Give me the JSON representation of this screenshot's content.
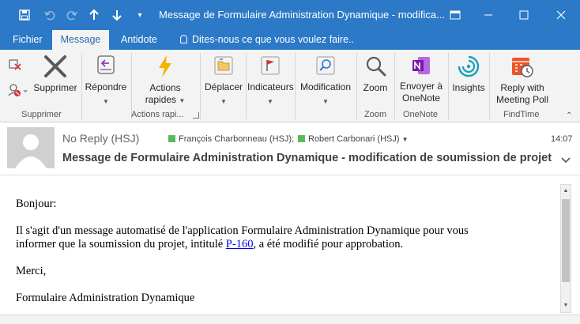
{
  "window": {
    "title": "Message de Formulaire Administration Dynamique - modifica...",
    "accent": "#2b79c7"
  },
  "quick_access": {
    "save_icon": "save-icon",
    "undo_icon": "undo-icon",
    "redo_icon": "redo-icon",
    "up_icon": "up-arrow-icon",
    "down_icon": "down-arrow-icon",
    "customize_icon": "customize-icon"
  },
  "tabs": [
    {
      "label": "Fichier"
    },
    {
      "label": "Message"
    },
    {
      "label": "Antidote"
    }
  ],
  "tell_me": "Dites-nous ce que vous voulez faire..",
  "ribbon": {
    "delete_label": "Supprimer",
    "reply_label": "Répondre",
    "quick_actions_l1": "Actions",
    "quick_actions_l2": "rapides",
    "move_label": "Déplacer",
    "tags_label": "Indicateurs",
    "edit_label": "Modification",
    "zoom_label": "Zoom",
    "onenote_l1": "Envoyer à",
    "onenote_l2": "OneNote",
    "insights_label": "Insights",
    "meeting_l1": "Reply with",
    "meeting_l2": "Meeting Poll",
    "groups": {
      "delete": "Supprimer",
      "quick_actions": "Actions rapi...",
      "zoom": "Zoom",
      "onenote": "OneNote",
      "findtime": "FindTime"
    }
  },
  "message": {
    "sender": "No Reply (HSJ)",
    "recipient1": "François Charbonneau (HSJ);",
    "recipient2": "Robert Carbonari (HSJ)",
    "time": "14:07",
    "subject": "Message de Formulaire Administration Dynamique - modification de soumission de projet"
  },
  "body": {
    "greeting": "Bonjour:",
    "line1": "Il s'agit d'un message automatisé de l'application Formulaire Administration Dynamique pour vous",
    "line2_before": "informer que la soumission du projet, intitulé ",
    "link": "P-160",
    "line2_after": ", a été modifié pour approbation.",
    "thanks": "Merci,",
    "signature": "Formulaire Administration Dynamique"
  }
}
